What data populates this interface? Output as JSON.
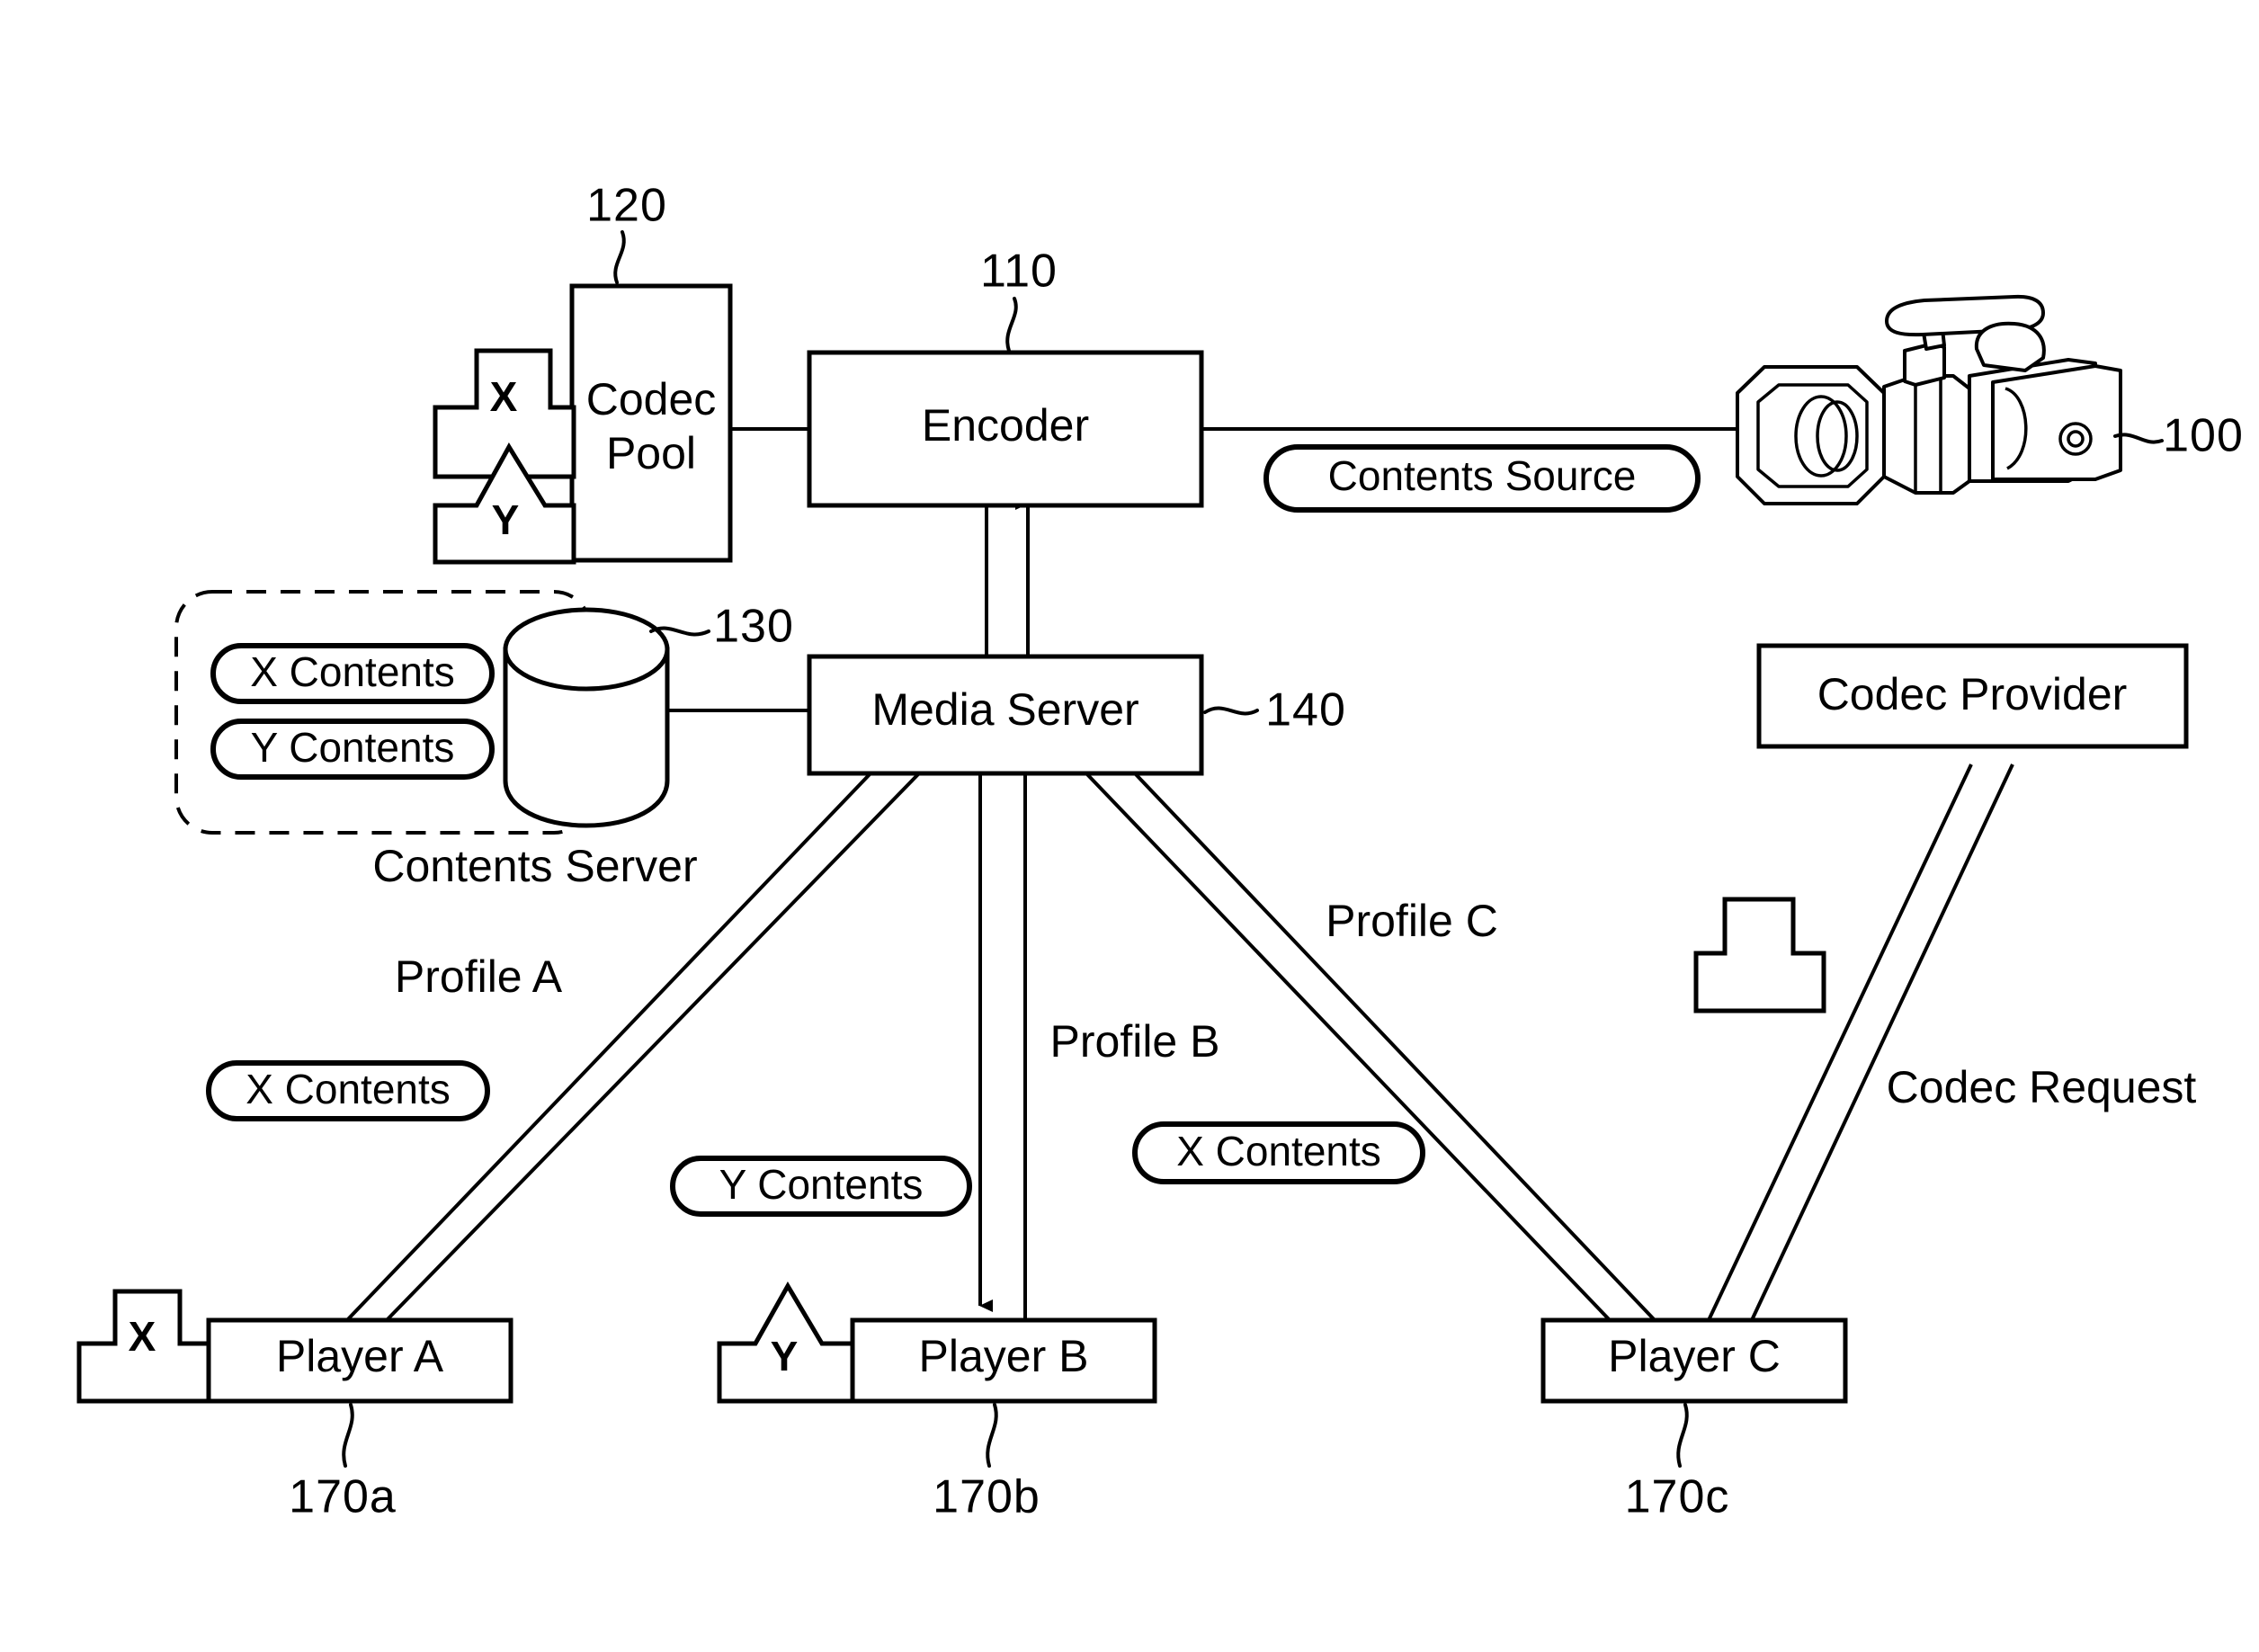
{
  "figure": {
    "type": "patent-system-diagram",
    "title": "Adaptive codec streaming system block diagram"
  },
  "blocks": {
    "codec_pool": {
      "label": "Codec Pool",
      "label_line1": "Codec",
      "label_line2": "Pool",
      "ref": "120"
    },
    "encoder": {
      "label": "Encoder",
      "ref": "110"
    },
    "media_server": {
      "label": "Media Server",
      "ref": "140"
    },
    "codec_provider": {
      "label": "Codec Provider",
      "ref": ""
    },
    "player_a": {
      "label": "Player A",
      "ref": "170a"
    },
    "player_b": {
      "label": "Player B",
      "ref": "170b"
    },
    "player_c": {
      "label": "Player C",
      "ref": "170c"
    }
  },
  "contents_server": {
    "group_label": "Contents Server",
    "db_ref": "130",
    "pills": [
      {
        "label": "X Contents"
      },
      {
        "label": "Y Contents"
      }
    ]
  },
  "source": {
    "device_ref": "100",
    "pill_label": "Contents Source",
    "icon": "camcorder-icon"
  },
  "codec_chips": {
    "pool_x": {
      "letter": "X",
      "shape": "rect-tab"
    },
    "pool_y": {
      "letter": "Y",
      "shape": "peak-tab"
    },
    "player_a": {
      "letter": "X",
      "shape": "rect-tab"
    },
    "player_b": {
      "letter": "Y",
      "shape": "peak-tab"
    },
    "provider": {
      "letter": "",
      "shape": "rect-tab"
    }
  },
  "flows": {
    "profile_a": {
      "label": "Profile A",
      "pill": "X Contents"
    },
    "profile_b": {
      "label": "Profile B",
      "pill": "Y Contents"
    },
    "profile_c": {
      "label": "Profile C",
      "pill": "X Contents"
    },
    "codec_request": {
      "label": "Codec Request"
    }
  },
  "style": {
    "ink": "#000000",
    "paper": "#ffffff"
  }
}
